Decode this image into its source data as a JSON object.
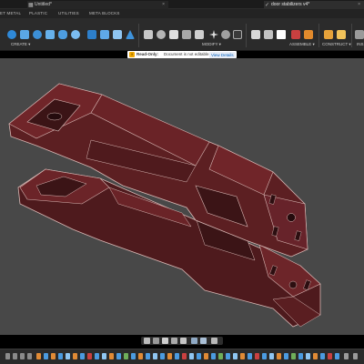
{
  "window_tabs": [
    {
      "label": "Untitled*"
    },
    {
      "label": "door stabilizers v4*"
    }
  ],
  "ribbon_tabs": [
    "ET METAL",
    "PLASTIC",
    "UTILITIES",
    "META BLOCKS"
  ],
  "toolbar_groups": [
    {
      "label": "CREATE ▾"
    },
    {
      "label": "MODIFY ▾"
    },
    {
      "label": "ASSEMBLE ▾"
    },
    {
      "label": "CONSTRUCT ▾"
    },
    {
      "label": "INS"
    }
  ],
  "banner": {
    "title": "Read-Only:",
    "message": "Document is not editable.",
    "action": "View Details"
  },
  "colors": {
    "model": "#5c1f22",
    "model_edge": "#d8b7b4",
    "viewport_bg": "#484848",
    "accent": "#1a8cff"
  }
}
